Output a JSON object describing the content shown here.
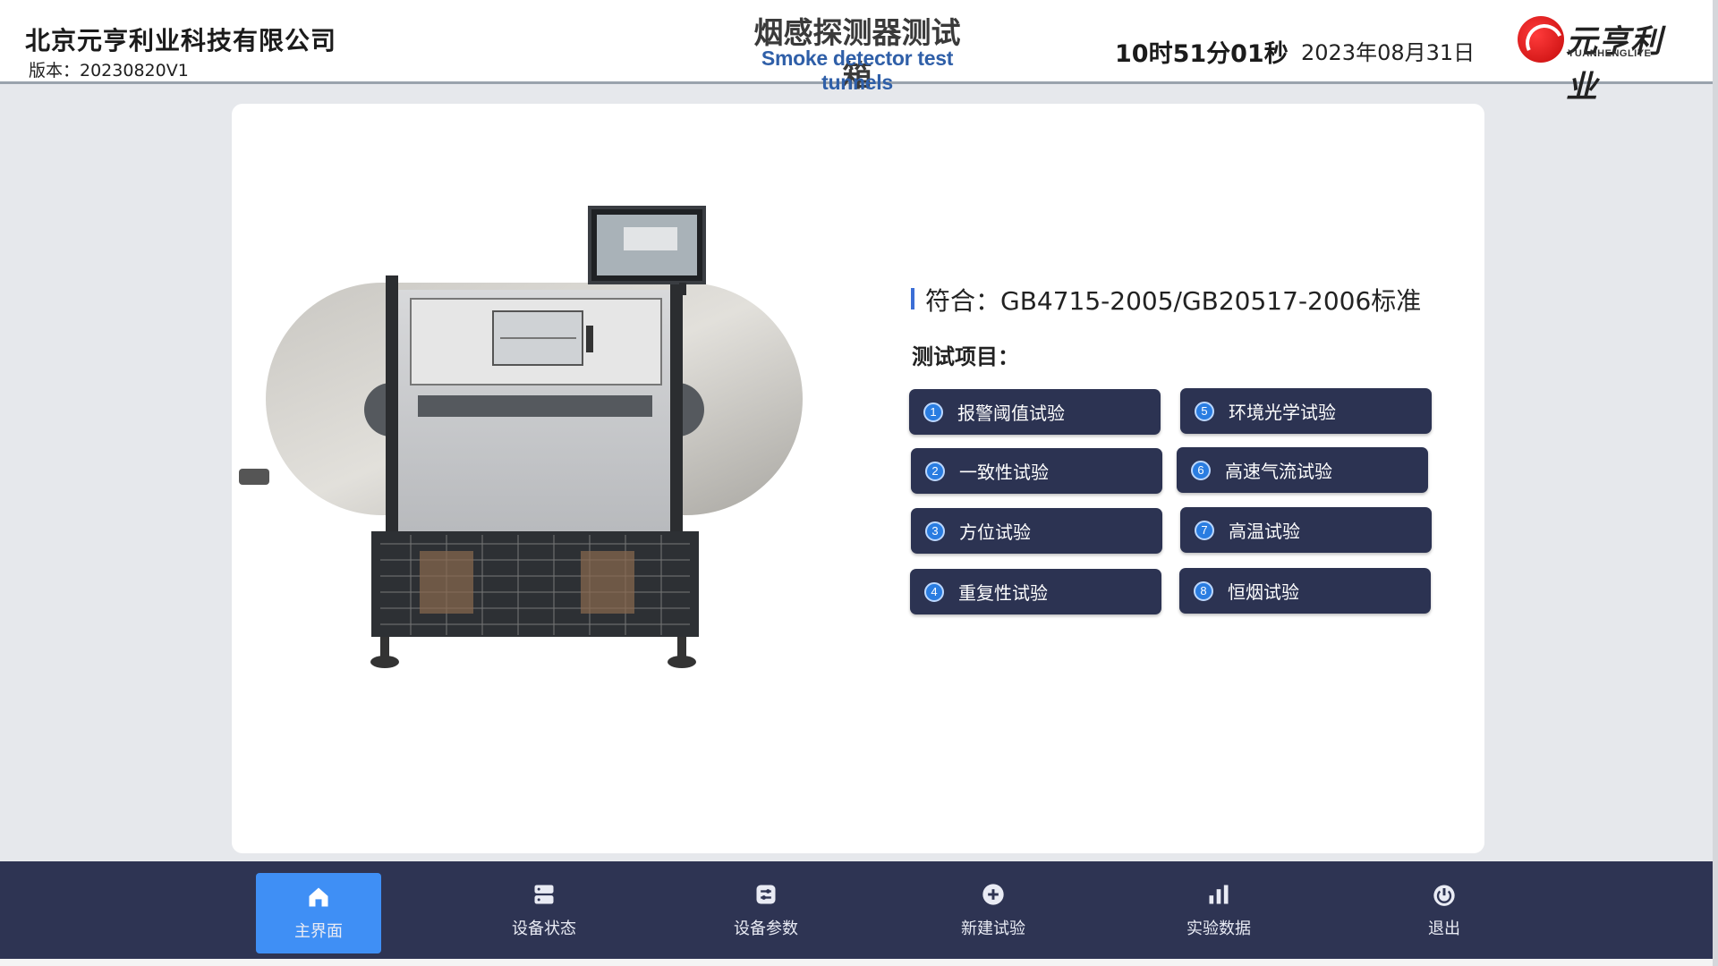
{
  "header": {
    "company": "北京元亨利业科技有限公司",
    "version": "版本：20230820V1",
    "title": "烟感探测器测试箱",
    "subtitle": "Smoke detector test tunnels",
    "time": "10时51分01秒",
    "date": "2023年08月31日",
    "logo_text": "元亨利业",
    "logo_sub": "YUANHENGLIYE"
  },
  "main": {
    "standard": "符合：GB4715-2005/GB20517-2006标准",
    "items_label": "测试项目：",
    "tests": [
      {
        "num": "1",
        "label": "报警阈值试验"
      },
      {
        "num": "2",
        "label": "一致性试验"
      },
      {
        "num": "3",
        "label": "方位试验"
      },
      {
        "num": "4",
        "label": "重复性试验"
      },
      {
        "num": "5",
        "label": "环境光学试验"
      },
      {
        "num": "6",
        "label": "高速气流试验"
      },
      {
        "num": "7",
        "label": "高温试验"
      },
      {
        "num": "8",
        "label": "恒烟试验"
      }
    ]
  },
  "nav": {
    "items": [
      {
        "label": "主界面",
        "icon": "home-icon",
        "active": true
      },
      {
        "label": "设备状态",
        "icon": "server-icon"
      },
      {
        "label": "设备参数",
        "icon": "sliders-icon"
      },
      {
        "label": "新建试验",
        "icon": "plus-circle-icon"
      },
      {
        "label": "实验数据",
        "icon": "bar-chart-icon"
      },
      {
        "label": "退出",
        "icon": "power-icon"
      }
    ]
  },
  "colors": {
    "nav_bg": "#2e3453",
    "nav_active": "#3f8ff5",
    "button_bg": "#2c3352",
    "accent_blue": "#3b6ed6",
    "subtitle_blue": "#2f5fa8"
  }
}
